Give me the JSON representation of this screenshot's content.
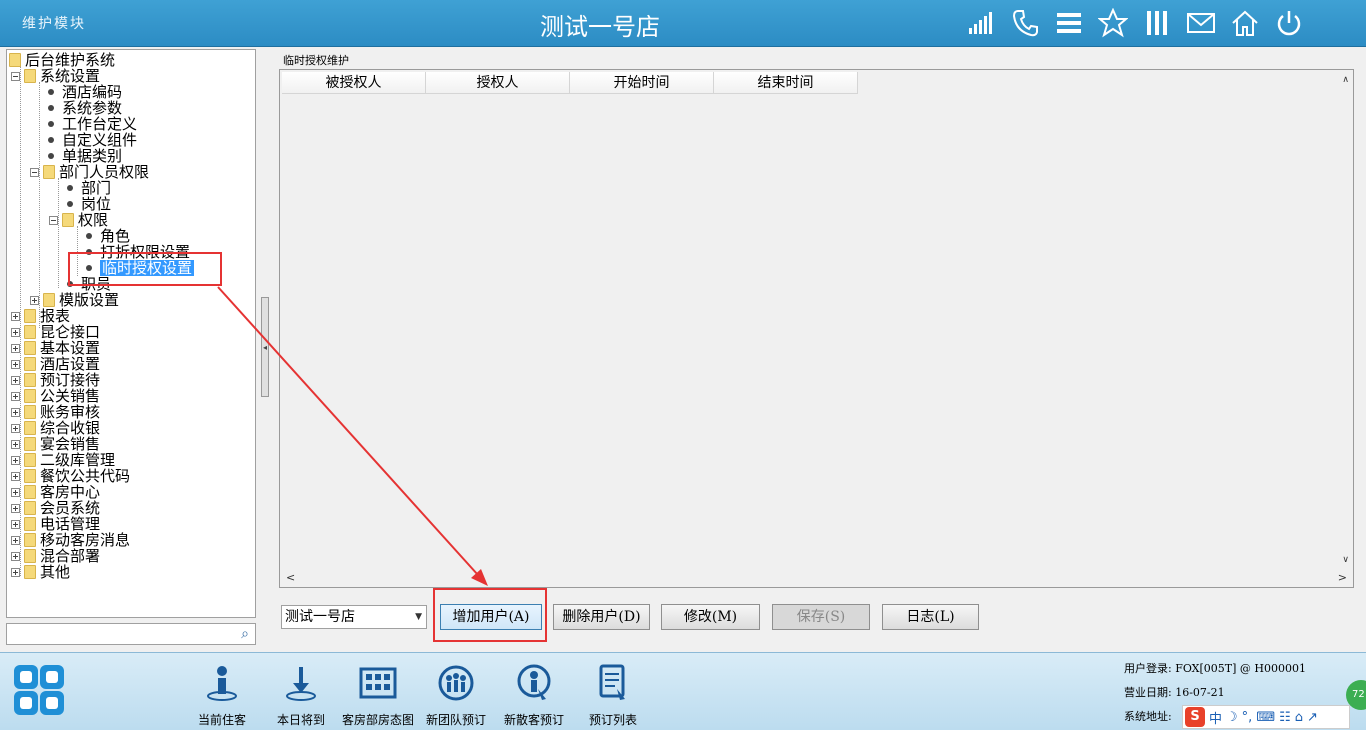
{
  "header": {
    "module_title": "维护模块",
    "store_title": "测试一号店",
    "icons": [
      "signal-icon",
      "phone-icon",
      "menu-icon",
      "star-icon",
      "columns-icon",
      "mail-icon",
      "home-icon",
      "power-icon"
    ]
  },
  "tree": {
    "root": "后台维护系统",
    "system_settings": "系统设置",
    "hotel_code": "酒店编码",
    "system_params": "系统参数",
    "workbench_def": "工作台定义",
    "custom_component": "自定义组件",
    "doc_category": "单据类别",
    "dept_staff_perm": "部门人员权限",
    "dept": "部门",
    "post": "岗位",
    "permission": "权限",
    "role": "角色",
    "discount_perm": "打折权限设置",
    "temp_auth": "临时授权设置",
    "staff": "职员",
    "template_settings": "模版设置",
    "reports": "报表",
    "kunlun_api": "昆仑接口",
    "basic_settings": "基本设置",
    "hotel_settings": "酒店设置",
    "reservation": "预订接待",
    "pr_sales": "公关销售",
    "account_audit": "账务审核",
    "cashier": "综合收银",
    "banquet_sales": "宴会销售",
    "secondary_warehouse": "二级库管理",
    "fnb_codes": "餐饮公共代码",
    "housekeeping": "客房中心",
    "member_system": "会员系统",
    "telephone": "电话管理",
    "mobile_room_msg": "移动客房消息",
    "mixed_deploy": "混合部署",
    "others": "其他"
  },
  "panel": {
    "group_title": "临时授权维护",
    "columns": [
      "被授权人",
      "授权人",
      "开始时间",
      "结束时间"
    ]
  },
  "controls": {
    "store_select": "测试一号店",
    "add_user": "增加用户(A)",
    "delete_user": "删除用户(D)",
    "modify": "修改(M)",
    "save": "保存(S)",
    "log": "日志(L)"
  },
  "bottom": {
    "items": [
      "当前住客",
      "本日将到",
      "客房部房态图",
      "新团队预订",
      "新散客预订",
      "预订列表"
    ],
    "user_login": "用户登录: FOX[005T] @ H000001",
    "business_date": "营业日期: 16-07-21",
    "system_addr": "系统地址:",
    "ime_text": "中",
    "globe_text": "72"
  },
  "colors": {
    "topbar": "#3fa1d4",
    "highlight": "#e53333",
    "selection": "#3399ff"
  }
}
